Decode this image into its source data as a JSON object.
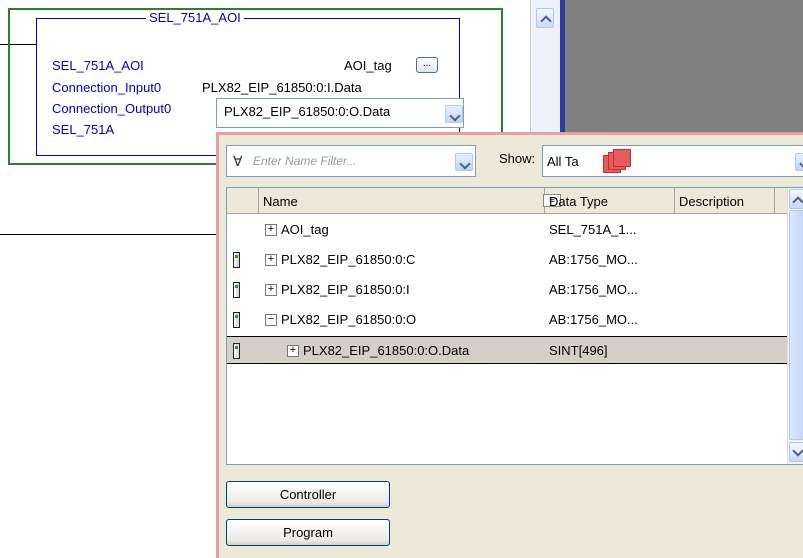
{
  "aoi": {
    "title": "SEL_751A_AOI",
    "name": "SEL_751A_AOI",
    "tag_label": "AOI_tag",
    "ellipsis": "...",
    "input_label": "Connection_Input0",
    "input_value": "PLX82_EIP_61850:0:I.Data",
    "output_label": "Connection_Output0",
    "output_value": "PLX82_EIP_61850:0:O.Data",
    "target_label": "SEL_751A"
  },
  "browser": {
    "filter_placeholder": "Enter Name Filter...",
    "show_label": "Show:",
    "show_value": "All Ta",
    "columns": {
      "name": "Name",
      "data_type": "Data Type",
      "description": "Description"
    },
    "rows": [
      {
        "name": "AOI_tag",
        "type": "SEL_751A_1...",
        "expander": "+",
        "module": false,
        "indent": 0,
        "selected": false
      },
      {
        "name": "PLX82_EIP_61850:0:C",
        "type": "AB:1756_MO...",
        "expander": "+",
        "module": true,
        "indent": 0,
        "selected": false
      },
      {
        "name": "PLX82_EIP_61850:0:I",
        "type": "AB:1756_MO...",
        "expander": "+",
        "module": true,
        "indent": 0,
        "selected": false
      },
      {
        "name": "PLX82_EIP_61850:0:O",
        "type": "AB:1756_MO...",
        "expander": "−",
        "module": true,
        "indent": 0,
        "selected": false
      },
      {
        "name": "PLX82_EIP_61850:0:O.Data",
        "type": "SINT[496]",
        "expander": "+",
        "module": true,
        "indent": 1,
        "selected": true
      }
    ],
    "buttons": {
      "controller": "Controller",
      "program": "Program"
    }
  }
}
